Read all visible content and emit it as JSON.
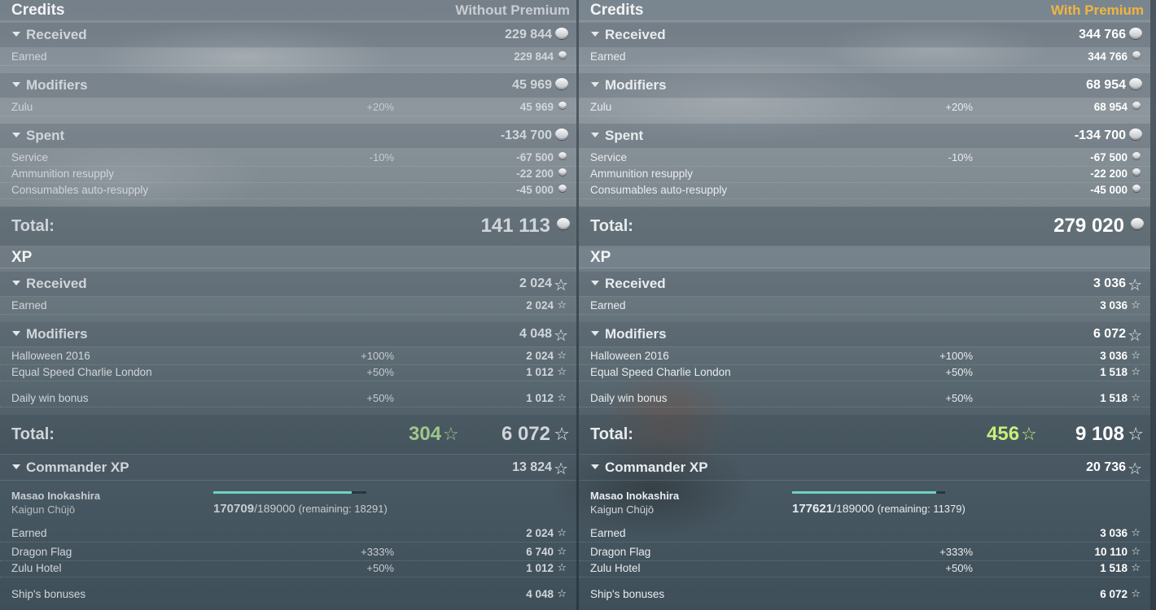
{
  "left": {
    "credits_title": "Credits",
    "premium_label": "Without Premium",
    "received": {
      "label": "Received",
      "value": "229 844"
    },
    "earned": {
      "label": "Earned",
      "value": "229 844"
    },
    "modifiers": {
      "label": "Modifiers",
      "value": "45 969"
    },
    "zulu": {
      "label": "Zulu",
      "pct": "+20%",
      "value": "45 969"
    },
    "spent": {
      "label": "Spent",
      "value": "-134 700"
    },
    "service": {
      "label": "Service",
      "pct": "-10%",
      "value": "-67 500"
    },
    "ammo": {
      "label": "Ammunition resupply",
      "value": "-22 200"
    },
    "consumables": {
      "label": "Consumables auto-resupply",
      "value": "-45 000"
    },
    "credits_total": {
      "label": "Total:",
      "value": "141 113"
    },
    "xp_title": "XP",
    "xp_received": {
      "label": "Received",
      "value": "2 024"
    },
    "xp_earned": {
      "label": "Earned",
      "value": "2 024"
    },
    "xp_modifiers": {
      "label": "Modifiers",
      "value": "4 048"
    },
    "halloween": {
      "label": "Halloween 2016",
      "pct": "+100%",
      "value": "2 024"
    },
    "equal_speed": {
      "label": "Equal Speed Charlie London",
      "pct": "+50%",
      "value": "1 012"
    },
    "daily_win": {
      "label": "Daily win bonus",
      "pct": "+50%",
      "value": "1 012"
    },
    "xp_total": {
      "label": "Total:",
      "bonus": "304",
      "value": "6 072"
    },
    "commander": {
      "label": "Commander XP",
      "value": "13 824",
      "name": "Masao Inokashira",
      "rank": "Kaigun Chūjō",
      "current": "170709",
      "max": "/189000",
      "remaining": "(remaining: 18291)",
      "progress": 0.903
    },
    "cmd_earned": {
      "label": "Earned",
      "value": "2 024"
    },
    "dragon_flag": {
      "label": "Dragon Flag",
      "pct": "+333%",
      "value": "6 740"
    },
    "zulu_hotel": {
      "label": "Zulu Hotel",
      "pct": "+50%",
      "value": "1 012"
    },
    "ship_bonuses": {
      "label": "Ship's bonuses",
      "value": "4 048"
    }
  },
  "right": {
    "credits_title": "Credits",
    "premium_label": "With Premium",
    "received": {
      "label": "Received",
      "value": "344 766"
    },
    "earned": {
      "label": "Earned",
      "value": "344 766"
    },
    "modifiers": {
      "label": "Modifiers",
      "value": "68 954"
    },
    "zulu": {
      "label": "Zulu",
      "pct": "+20%",
      "value": "68 954"
    },
    "spent": {
      "label": "Spent",
      "value": "-134 700"
    },
    "service": {
      "label": "Service",
      "pct": "-10%",
      "value": "-67 500"
    },
    "ammo": {
      "label": "Ammunition resupply",
      "value": "-22 200"
    },
    "consumables": {
      "label": "Consumables auto-resupply",
      "value": "-45 000"
    },
    "credits_total": {
      "label": "Total:",
      "value": "279 020"
    },
    "xp_title": "XP",
    "xp_received": {
      "label": "Received",
      "value": "3 036"
    },
    "xp_earned": {
      "label": "Earned",
      "value": "3 036"
    },
    "xp_modifiers": {
      "label": "Modifiers",
      "value": "6 072"
    },
    "halloween": {
      "label": "Halloween 2016",
      "pct": "+100%",
      "value": "3 036"
    },
    "equal_speed": {
      "label": "Equal Speed Charlie London",
      "pct": "+50%",
      "value": "1 518"
    },
    "daily_win": {
      "label": "Daily win bonus",
      "pct": "+50%",
      "value": "1 518"
    },
    "xp_total": {
      "label": "Total:",
      "bonus": "456",
      "value": "9 108"
    },
    "commander": {
      "label": "Commander XP",
      "value": "20 736",
      "name": "Masao Inokashira",
      "rank": "Kaigun Chūjō",
      "current": "177621",
      "max": "/189000",
      "remaining": "(remaining: 11379)",
      "progress": 0.94
    },
    "cmd_earned": {
      "label": "Earned",
      "value": "3 036"
    },
    "dragon_flag": {
      "label": "Dragon Flag",
      "pct": "+333%",
      "value": "10 110"
    },
    "zulu_hotel": {
      "label": "Zulu Hotel",
      "pct": "+50%",
      "value": "1 518"
    },
    "ship_bonuses": {
      "label": "Ship's bonuses",
      "value": "6 072"
    }
  },
  "colors": {
    "premium_gold": "#f0b540",
    "xp_bonus_left": "#9fc78a",
    "xp_bonus_right": "#c6f07a",
    "progress_fill": "#6fd1c4"
  },
  "icons": {
    "credits": "silver-coin-icon",
    "xp": "star-icon"
  }
}
